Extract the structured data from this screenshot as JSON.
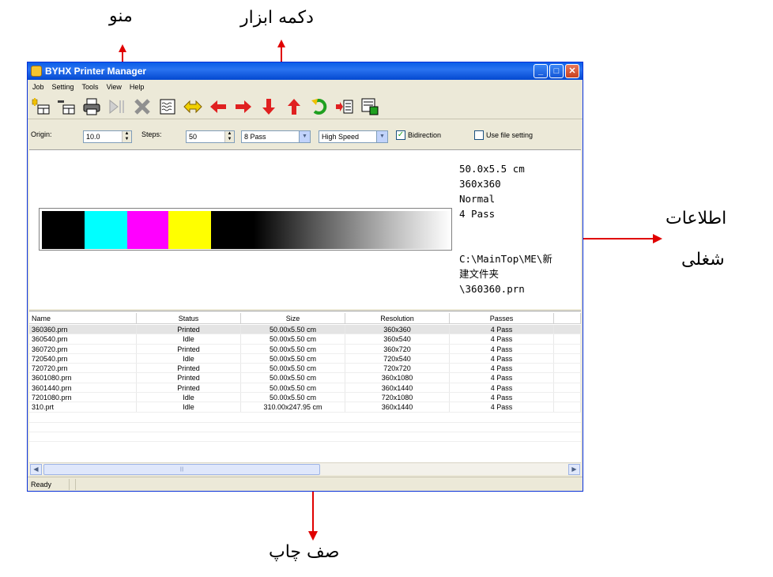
{
  "annotations": {
    "menu": "منو",
    "toolbar_buttons": "دکمه ابزار",
    "job_info_line1": "اطلاعات",
    "job_info_line2": "شغلی",
    "print_queue": "صف چاپ",
    "arrow_color": "#e00000"
  },
  "window": {
    "title": "BYHX Printer Manager",
    "buttons": {
      "minimize": "_",
      "maximize": "□",
      "close": "✕"
    }
  },
  "menu": [
    "Job",
    "Setting",
    "Tools",
    "View",
    "Help"
  ],
  "toolbar": {
    "icons": [
      "add-job-icon",
      "remove-job-icon",
      "print-icon",
      "pause-icon",
      "cancel-icon",
      "head-clean-icon",
      "move-horizontal-icon",
      "move-left-icon",
      "move-right-icon",
      "move-down-icon",
      "move-up-icon",
      "refresh-icon",
      "import-icon",
      "job-settings-icon"
    ]
  },
  "options": {
    "origin_label": "Origin:",
    "origin_value": "10.0",
    "steps_label": "Steps:",
    "steps_value": "50",
    "pass_value": "8 Pass",
    "speed_value": "High Speed",
    "bidirection_label": "Bidirection",
    "bidirection_checked": true,
    "use_file_setting_label": "Use file setting",
    "use_file_setting_checked": false
  },
  "preview": {
    "swatches": [
      "#000000",
      "#00ffff",
      "#ff00ff",
      "#ffff00",
      "#000000"
    ],
    "info": {
      "size": "50.0x5.5 cm",
      "resolution": "360x360",
      "quality": "Normal",
      "passes": "4 Pass",
      "path1": "C:\\MainTop\\ME\\新",
      "path2": "建文件夹",
      "path3": "\\360360.prn"
    }
  },
  "queue": {
    "headers": {
      "name": "Name",
      "status": "Status",
      "size": "Size",
      "resolution": "Resolution",
      "passes": "Passes"
    },
    "rows": [
      {
        "name": "360360.prn",
        "status": "Printed",
        "size": "50.00x5.50 cm",
        "resolution": "360x360",
        "passes": "4 Pass"
      },
      {
        "name": "360540.prn",
        "status": "Idle",
        "size": "50.00x5.50 cm",
        "resolution": "360x540",
        "passes": "4 Pass"
      },
      {
        "name": "360720.prn",
        "status": "Printed",
        "size": "50.00x5.50 cm",
        "resolution": "360x720",
        "passes": "4 Pass"
      },
      {
        "name": "720540.prn",
        "status": "Idle",
        "size": "50.00x5.50 cm",
        "resolution": "720x540",
        "passes": "4 Pass"
      },
      {
        "name": "720720.prn",
        "status": "Printed",
        "size": "50.00x5.50 cm",
        "resolution": "720x720",
        "passes": "4 Pass"
      },
      {
        "name": "3601080.prn",
        "status": "Printed",
        "size": "50.00x5.50 cm",
        "resolution": "360x1080",
        "passes": "4 Pass"
      },
      {
        "name": "3601440.prn",
        "status": "Printed",
        "size": "50.00x5.50 cm",
        "resolution": "360x1440",
        "passes": "4 Pass"
      },
      {
        "name": "7201080.prn",
        "status": "Idle",
        "size": "50.00x5.50 cm",
        "resolution": "720x1080",
        "passes": "4 Pass"
      },
      {
        "name": "310.prt",
        "status": "Idle",
        "size": "310.00x247.95 cm",
        "resolution": "360x1440",
        "passes": "4 Pass"
      }
    ]
  },
  "statusbar": {
    "text": "Ready"
  }
}
